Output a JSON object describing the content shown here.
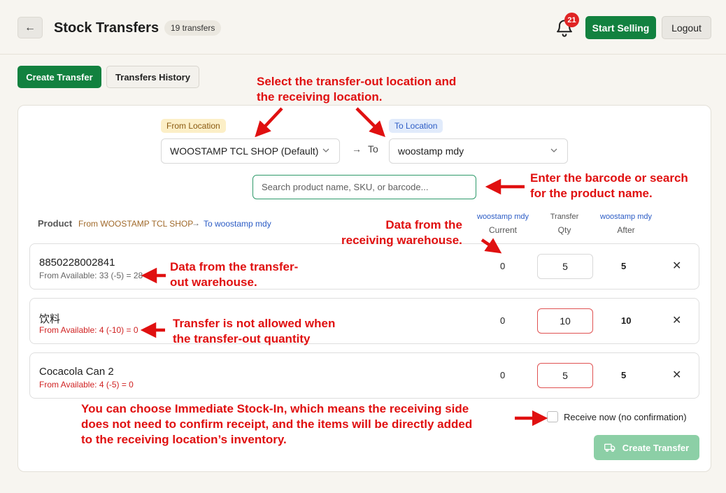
{
  "header": {
    "back_label": "←",
    "title": "Stock Transfers",
    "count_badge": "19 transfers",
    "notifications": "21",
    "start_selling": "Start Selling",
    "logout": "Logout"
  },
  "tabs": {
    "create": "Create Transfer",
    "history": "Transfers History"
  },
  "locations": {
    "from_tag": "From Location",
    "from_value": "WOOSTAMP TCL SHOP (Default)",
    "to_word": "To",
    "to_tag": "To Location",
    "to_value": "woostamp mdy"
  },
  "search": {
    "placeholder": "Search product name, SKU, or barcode..."
  },
  "table": {
    "product_label": "Product",
    "from_label": "From WOOSTAMP TCL SHOP",
    "to_label": "To woostamp mdy",
    "current_top": "woostamp mdy",
    "current_bot": "Current",
    "qty_top": "Transfer",
    "qty_bot": "Qty",
    "after_top": "woostamp mdy",
    "after_bot": "After",
    "rows": [
      {
        "name": "8850228002841",
        "avail": "From Available: 33 (-5) = 28",
        "current": "0",
        "qty": "5",
        "after": "5"
      },
      {
        "name": "饮料",
        "avail": "From Available: 4 (-10) = 0",
        "current": "0",
        "qty": "10",
        "after": "10"
      },
      {
        "name": "Cocacola Can 2",
        "avail": "From Available: 4 (-5) = 0",
        "current": "0",
        "qty": "5",
        "after": "5"
      }
    ]
  },
  "footer": {
    "receive_now": "Receive now (no confirmation)",
    "submit": "Create Transfer"
  },
  "annotations": {
    "select_note_1": "Select the transfer-out location and",
    "select_note_2": "the receiving location.",
    "search_note_1": "Enter the barcode or search",
    "search_note_2": "for the product name.",
    "receiving_note_1": "Data from the",
    "receiving_note_2": "receiving warehouse.",
    "transferout_note_1": "Data from the transfer-",
    "transferout_note_2": "out warehouse.",
    "notallowed_note_1": "Transfer is not allowed when",
    "notallowed_note_2": "the transfer-out quantity",
    "immediate_note_1": "You can choose Immediate Stock-In, which means the receiving side",
    "immediate_note_2": "does not need to confirm receipt, and the items will be directly added",
    "immediate_note_3": "to the receiving location’s inventory."
  },
  "colors": {
    "primary_green": "#12813f",
    "annotation_red": "#e01010",
    "to_blue": "#2c5cc5",
    "from_brown": "#a0692a"
  }
}
